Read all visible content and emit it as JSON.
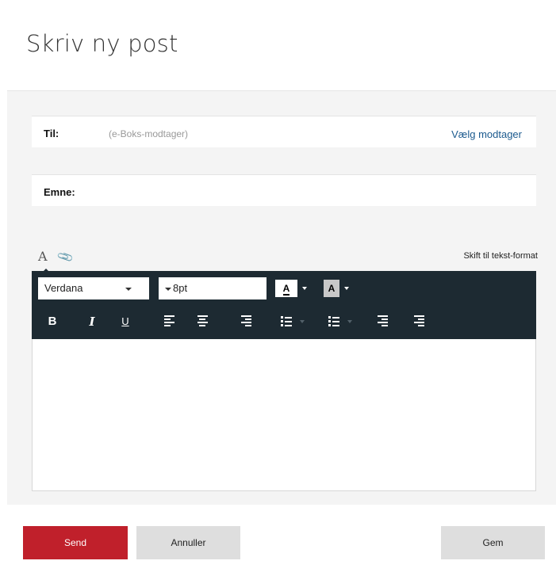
{
  "page": {
    "title": "Skriv ny post"
  },
  "recipient": {
    "label": "Til:",
    "placeholder": "(e-Boks-modtager)",
    "choose_link": "Vælg modtager"
  },
  "subject": {
    "label": "Emne:",
    "value": ""
  },
  "editor": {
    "switch_format_link": "Skift til tekst-format",
    "font_family": "Verdana",
    "font_size": "8pt",
    "text_color_glyph": "A",
    "bg_color_glyph": "A",
    "format_buttons": {
      "bold": "B",
      "italic": "I",
      "underline": "U"
    },
    "content": ""
  },
  "actions": {
    "send": "Send",
    "cancel": "Annuller",
    "save": "Gem"
  },
  "colors": {
    "send_button": "#c0202b",
    "toolbar_bg": "#1d2a32",
    "link": "#1b5a8e"
  }
}
